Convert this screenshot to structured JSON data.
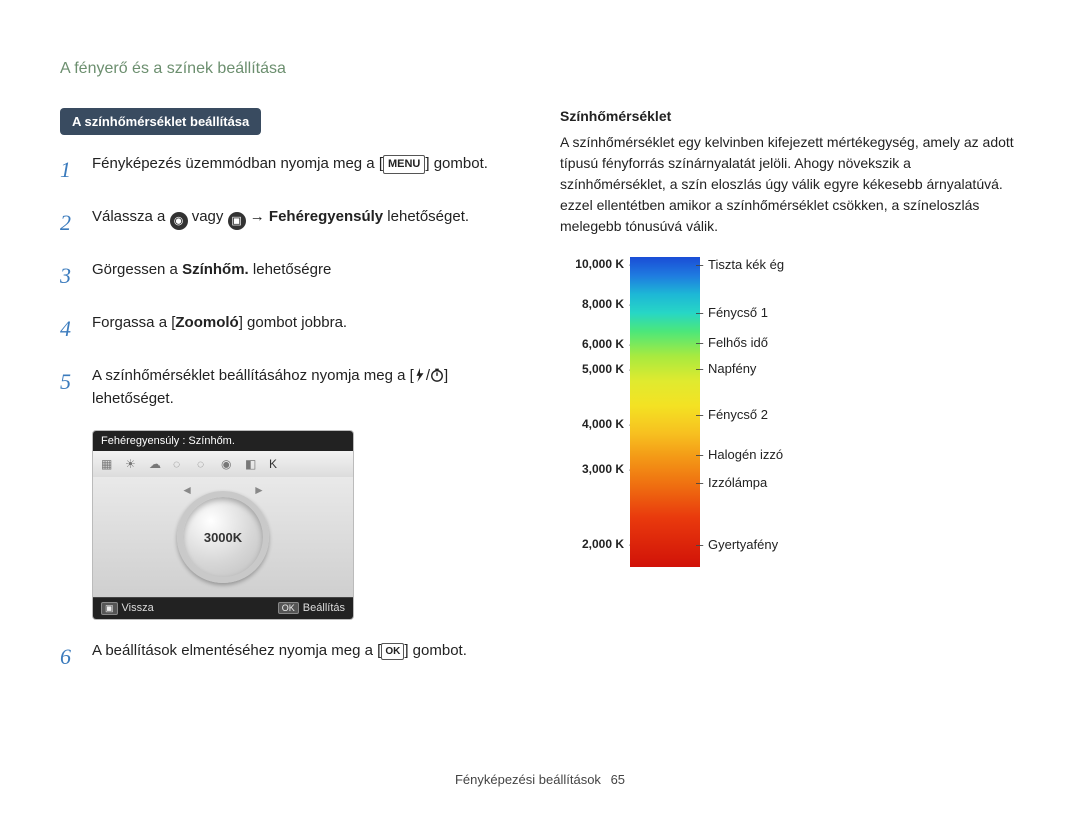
{
  "page_title": "A fényerő és a színek beállítása",
  "section_badge": "A színhőmérséklet beállítása",
  "steps": {
    "s1a": "Fényképezés üzemmódban nyomja meg a [",
    "s1_menu": "MENU",
    "s1b": "] gombot.",
    "s2a": "Válassza a ",
    "s2_or": " vagy ",
    "s2_arrow": " → ",
    "s2_bold": "Fehéregyensúly",
    "s2b": " lehetőséget.",
    "s3a": "Görgessen a ",
    "s3_bold": "Színhőm.",
    "s3b": " lehetőségre",
    "s4a": "Forgassa a [",
    "s4_bold": "Zoomoló",
    "s4b": "] gombot jobbra.",
    "s5a": "A színhőmérséklet beállításához nyomja meg a [",
    "s5_sep": "/",
    "s5b": "] lehetőséget.",
    "s6a": "A beállítások elmentéséhez nyomja meg a [",
    "s6_ok": "OK",
    "s6b": "] gombot."
  },
  "device": {
    "title": "Fehéregyensúly : Színhőm.",
    "dial_value": "3000K",
    "back": "Vissza",
    "set": "Beállítás",
    "ok": "OK"
  },
  "right": {
    "heading": "Színhőmérséklet",
    "paragraph": "A színhőmérséklet egy kelvinben kifejezett mértékegység, amely az adott típusú fényforrás színárnyalatát jelöli. Ahogy növekszik a színhőmérséklet, a szín eloszlás úgy válik egyre kékesebb árnyalatúvá. ezzel ellentétben amikor a színhőmérséklet csökken, a színeloszlás melegebb tónusúvá válik."
  },
  "chart_data": {
    "type": "table",
    "title": "Színhőmérséklet",
    "ylabel": "K",
    "ylim": [
      2000,
      10000
    ],
    "left_ticks": [
      {
        "k": "10,000 K",
        "pos": 0
      },
      {
        "k": "8,000 K",
        "pos": 40
      },
      {
        "k": "6,000 K",
        "pos": 80
      },
      {
        "k": "5,000 K",
        "pos": 105
      },
      {
        "k": "4,000 K",
        "pos": 160
      },
      {
        "k": "3,000 K",
        "pos": 205
      },
      {
        "k": "2,000 K",
        "pos": 280
      }
    ],
    "right_labels": [
      {
        "label": "Tiszta kék ég",
        "pos": 0
      },
      {
        "label": "Fénycső 1",
        "pos": 48
      },
      {
        "label": "Felhős idő",
        "pos": 78
      },
      {
        "label": "Napfény",
        "pos": 104
      },
      {
        "label": "Fénycső 2",
        "pos": 150
      },
      {
        "label": "Halogén izzó",
        "pos": 190
      },
      {
        "label": "Izzólámpa",
        "pos": 218
      },
      {
        "label": "Gyertyafény",
        "pos": 280
      }
    ]
  },
  "footer": {
    "section": "Fényképezési beállítások",
    "page": "65"
  }
}
